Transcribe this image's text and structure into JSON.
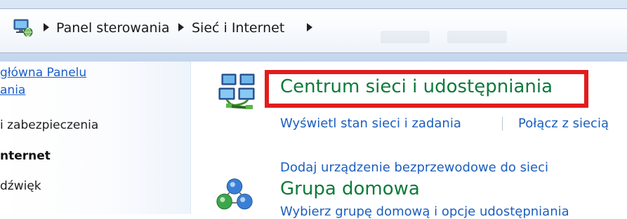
{
  "breadcrumb": {
    "items": [
      {
        "label": "Panel sterowania"
      },
      {
        "label": "Sieć i Internet"
      }
    ]
  },
  "nav": {
    "home_link_line1": "główna Panelu",
    "home_link_line2": "ania",
    "item_security": "i zabezpieczenia",
    "item_network_active": "nternet",
    "item_partial": "dźwięk"
  },
  "categories": [
    {
      "title": "Centrum sieci i udostępniania",
      "tasks": [
        "Wyświetl stan sieci i zadania",
        "Połącz z siecią",
        "Dodaj urządzenie bezprzewodowe do sieci"
      ]
    },
    {
      "title": "Grupa domowa",
      "tasks": [
        "Wybierz grupę domową i opcje udostępniania"
      ]
    }
  ],
  "colors": {
    "highlight": "#e21c1c",
    "category_title": "#0f7a3a",
    "link": "#1c5fbe"
  },
  "icons": {
    "breadcrumb": "network-computer-icon",
    "network_center": "network-computers-icon",
    "homegroup": "homegroup-icon"
  }
}
